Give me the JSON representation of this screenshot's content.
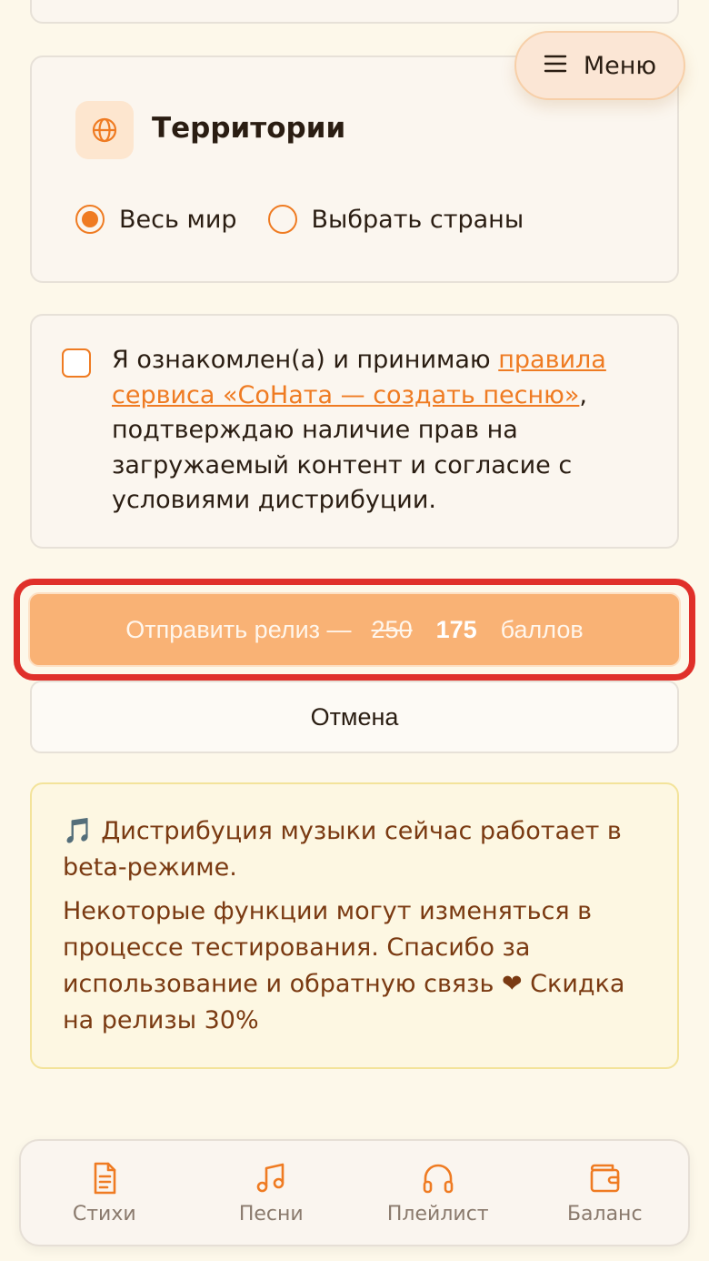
{
  "menu": {
    "label": "Меню",
    "icon": "hamburger-icon"
  },
  "territories": {
    "title": "Территории",
    "icon": "globe-icon",
    "options": [
      {
        "label": "Весь мир",
        "selected": true
      },
      {
        "label": "Выбрать страны",
        "selected": false
      }
    ]
  },
  "consent": {
    "checked": false,
    "text_before": "Я ознакомлен(а) и принимаю ",
    "link_text": "правила сервиса «СоНата — создать песню»",
    "text_after": ", подтверждаю наличие прав на загружаемый контент и согласие с условиями дистрибуции."
  },
  "submit": {
    "label": "Отправить релиз —",
    "old_price": "250",
    "new_price": "175",
    "unit": "баллов"
  },
  "cancel": {
    "label": "Отмена"
  },
  "notice": {
    "line1": "🎵 Дистрибуция музыки сейчас работает в beta-режиме.",
    "line2": "Некоторые функции могут изменяться в процессе тестирования. Спасибо за использование и обратную связь ❤ Скидка на релизы 30%"
  },
  "nav": {
    "items": [
      {
        "label": "Стихи",
        "icon": "document-icon"
      },
      {
        "label": "Песни",
        "icon": "music-note-icon"
      },
      {
        "label": "Плейлист",
        "icon": "headphones-icon"
      },
      {
        "label": "Баланс",
        "icon": "wallet-icon"
      }
    ]
  },
  "colors": {
    "accent": "#ef7b22",
    "submit_bg": "#f9b275",
    "notice_text": "#7a3a12",
    "highlight": "#e0302a"
  }
}
